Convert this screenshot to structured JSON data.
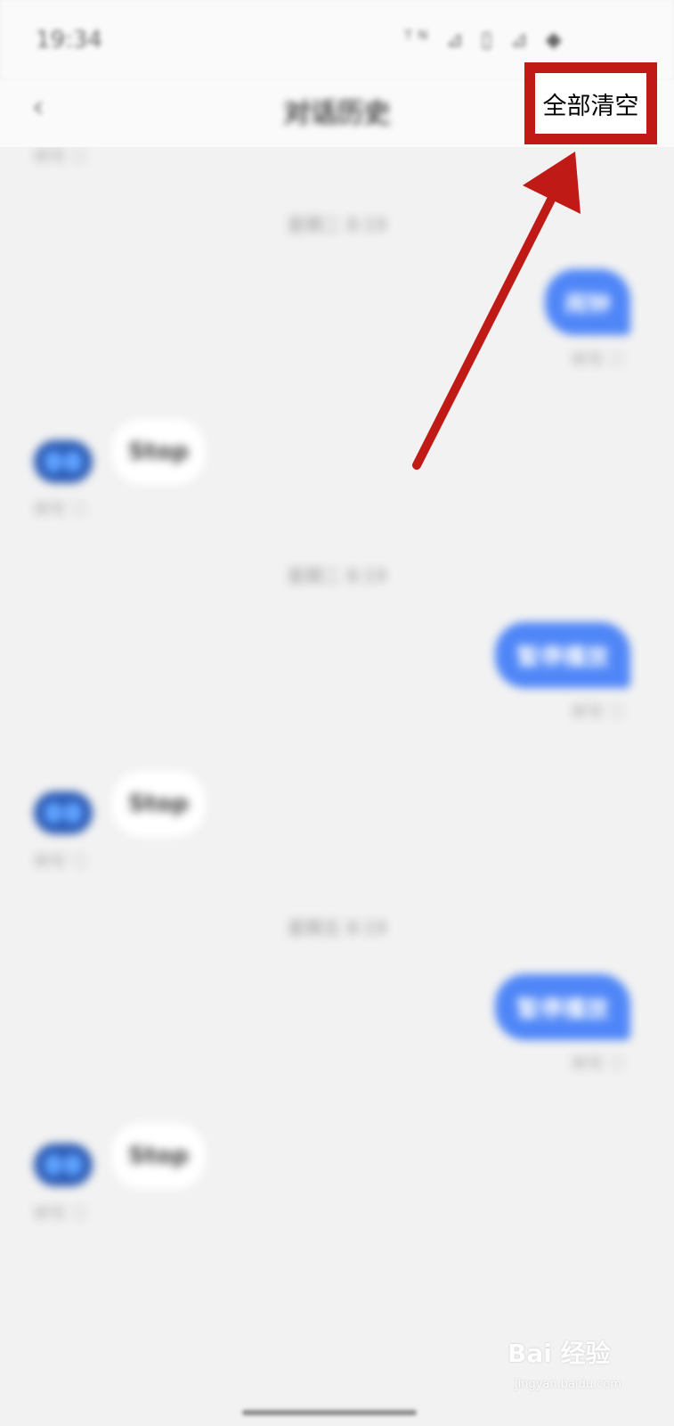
{
  "status_bar": {
    "time": "19:34",
    "icons": "ᵀᴺ ⊿ ▯ ⊿ ◆"
  },
  "nav": {
    "back_icon": "‹",
    "title": "对话历史",
    "clear_all": "全部清空"
  },
  "messages": [
    {
      "read_label": "转写 ⓘ"
    },
    {
      "timestamp": "星期二 8:19"
    },
    {
      "user_text": "闹钟",
      "read_label": "转写 ⓘ"
    },
    {
      "bot_text": "Stop",
      "read_label": "转写 ⓘ"
    },
    {
      "timestamp": "星期二 8:19"
    },
    {
      "user_text": "暂停播放",
      "read_label": "转写 ⓘ"
    },
    {
      "bot_text": "Stop",
      "read_label": "转写 ⓘ"
    },
    {
      "timestamp": "星期五 8:19"
    },
    {
      "user_text": "暂停播放",
      "read_label": "转写 ⓘ"
    },
    {
      "bot_text": "Stop",
      "read_label": "转写 ⓘ"
    }
  ],
  "watermark": {
    "text": "Bai 经验",
    "sub": "jingyan.baidu.com"
  },
  "colors": {
    "accent": "#c01a17",
    "user_bubble": "#4f86f7"
  }
}
